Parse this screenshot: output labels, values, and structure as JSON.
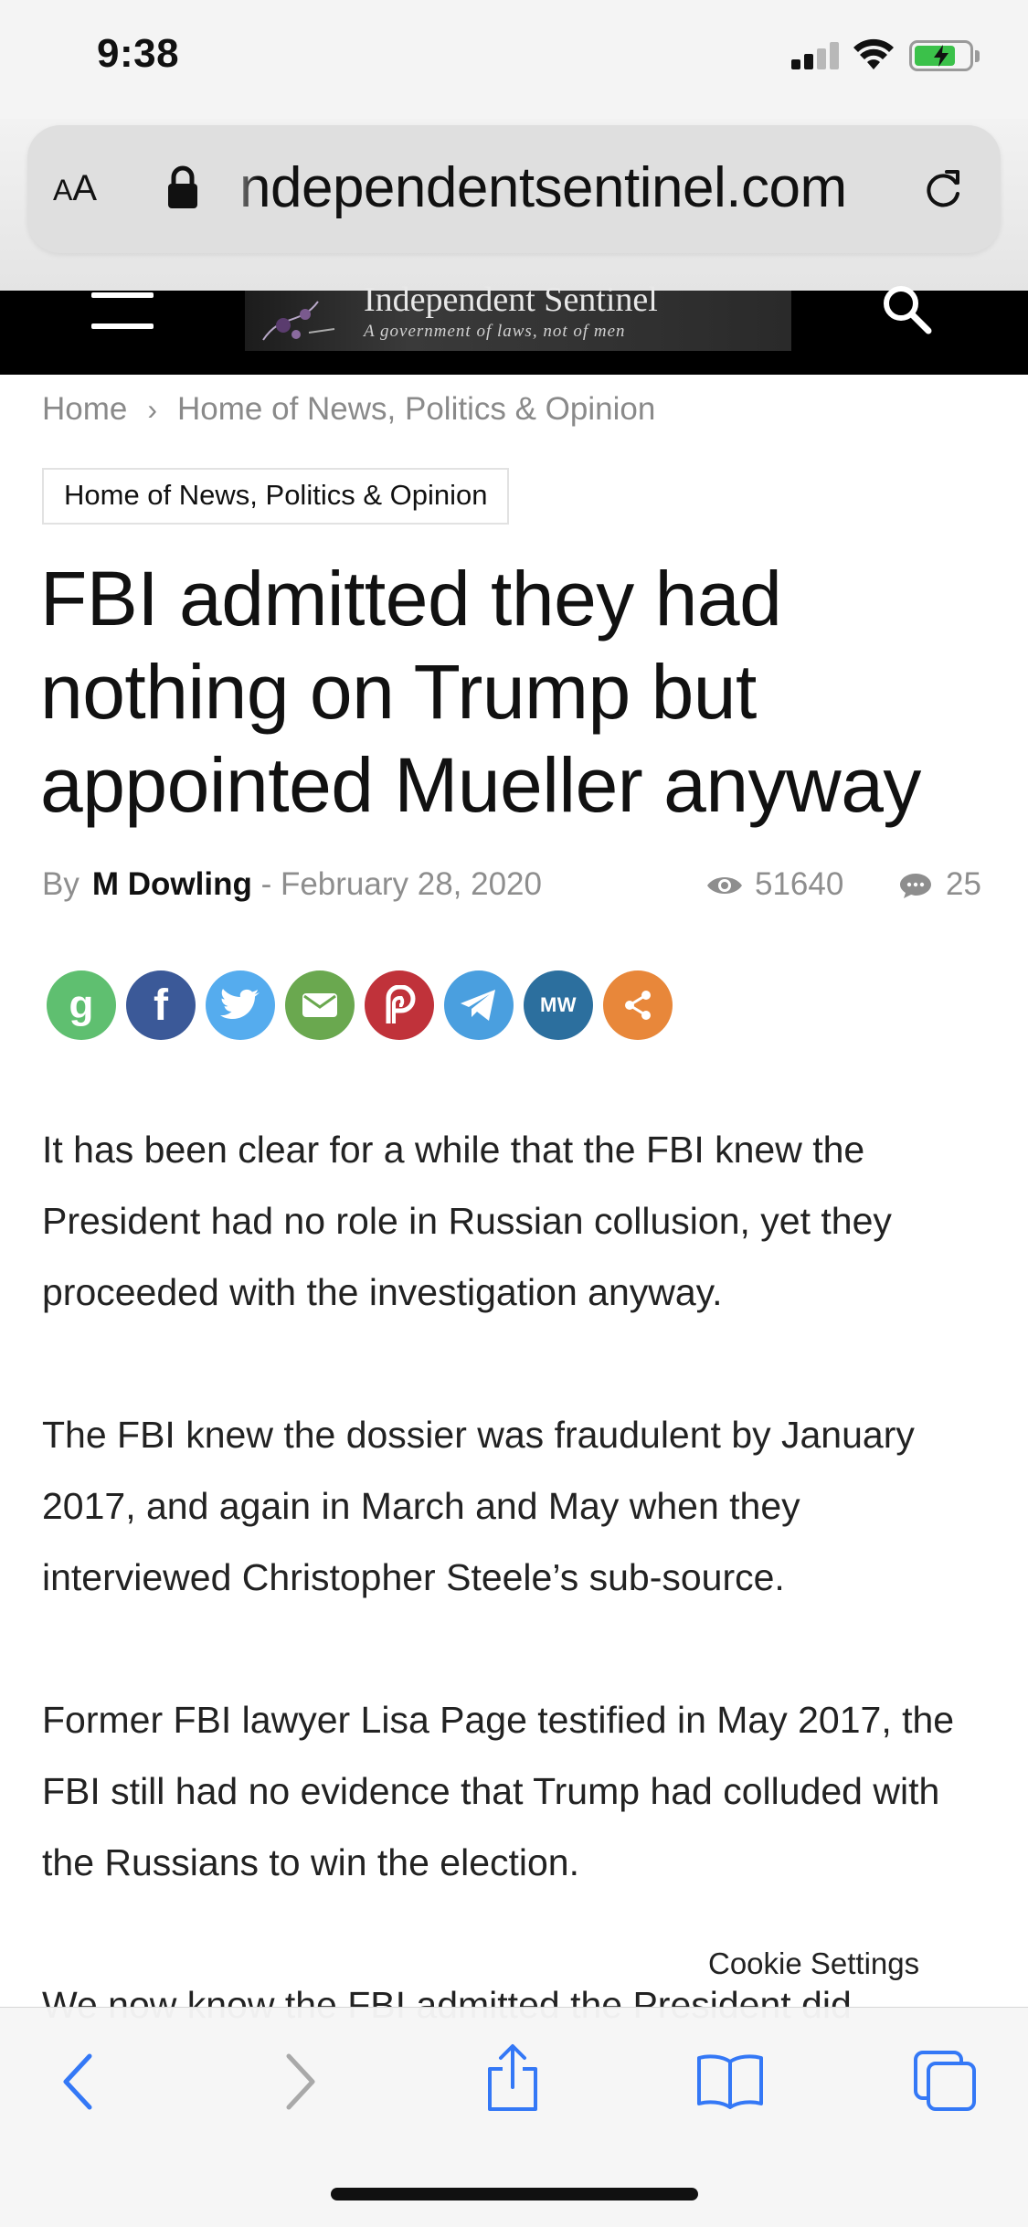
{
  "status_bar": {
    "time": "9:38",
    "battery_level": 0.75,
    "battery_color": "#3bc14a"
  },
  "browser": {
    "text_size_label": "AA",
    "url": "ndependentsentinel.com",
    "reload_icon": "reload-icon",
    "lock_icon": "lock-icon"
  },
  "site": {
    "logo_title": "Independent Sentinel",
    "logo_tagline": "A government of laws, not of men",
    "menu_icon": "hamburger-menu-icon",
    "search_icon": "search-icon"
  },
  "breadcrumb": {
    "home": "Home",
    "separator": "›",
    "section": "Home of News, Politics & Opinion"
  },
  "article": {
    "category": "Home of News, Politics & Opinion",
    "title": "FBI admitted they had nothing on Trump but appointed Mueller anyway",
    "by_label": "By",
    "author": "M Dowling",
    "dash": "-",
    "date": "February 28, 2020",
    "views": "51640",
    "comments": "25",
    "paragraphs": [
      "It has been clear for a while that the FBI knew the President had no role in Russian collusion, yet they proceeded with the investigation anyway.",
      "The FBI knew the dossier was fraudulent by January 2017, and again in March and May when they interviewed Christopher Steele’s sub-source.",
      "Former FBI lawyer Lisa Page testified in May 2017, the FBI still had no evidence that Trump had colluded with the Russians to win the election.",
      "We now know the FBI admitted the President did"
    ]
  },
  "share_buttons": [
    {
      "name": "gab",
      "icon": "gab-icon",
      "color": "#5fbf70",
      "glyph": "g"
    },
    {
      "name": "facebook",
      "icon": "facebook-icon",
      "color": "#3b5998",
      "glyph": "f"
    },
    {
      "name": "twitter",
      "icon": "twitter-icon",
      "color": "#55acee",
      "glyph": ""
    },
    {
      "name": "email",
      "icon": "email-icon",
      "color": "#6aa84f",
      "glyph": ""
    },
    {
      "name": "parler",
      "icon": "parler-icon",
      "color": "#c0323a",
      "glyph": "P"
    },
    {
      "name": "telegram",
      "icon": "telegram-icon",
      "color": "#4a9fdf",
      "glyph": ""
    },
    {
      "name": "mewe",
      "icon": "mewe-icon",
      "color": "#2c6f9e",
      "glyph": "MW"
    },
    {
      "name": "more",
      "icon": "share-icon",
      "color": "#e8873a",
      "glyph": ""
    }
  ],
  "cookie": {
    "label": "Cookie Settings"
  },
  "toolbar": {
    "back_icon": "back-chevron-icon",
    "forward_icon": "forward-chevron-icon",
    "share_icon": "share-icon",
    "bookmarks_icon": "bookmarks-book-icon",
    "tabs_icon": "tabs-icon",
    "accent_color": "#3478f6"
  }
}
